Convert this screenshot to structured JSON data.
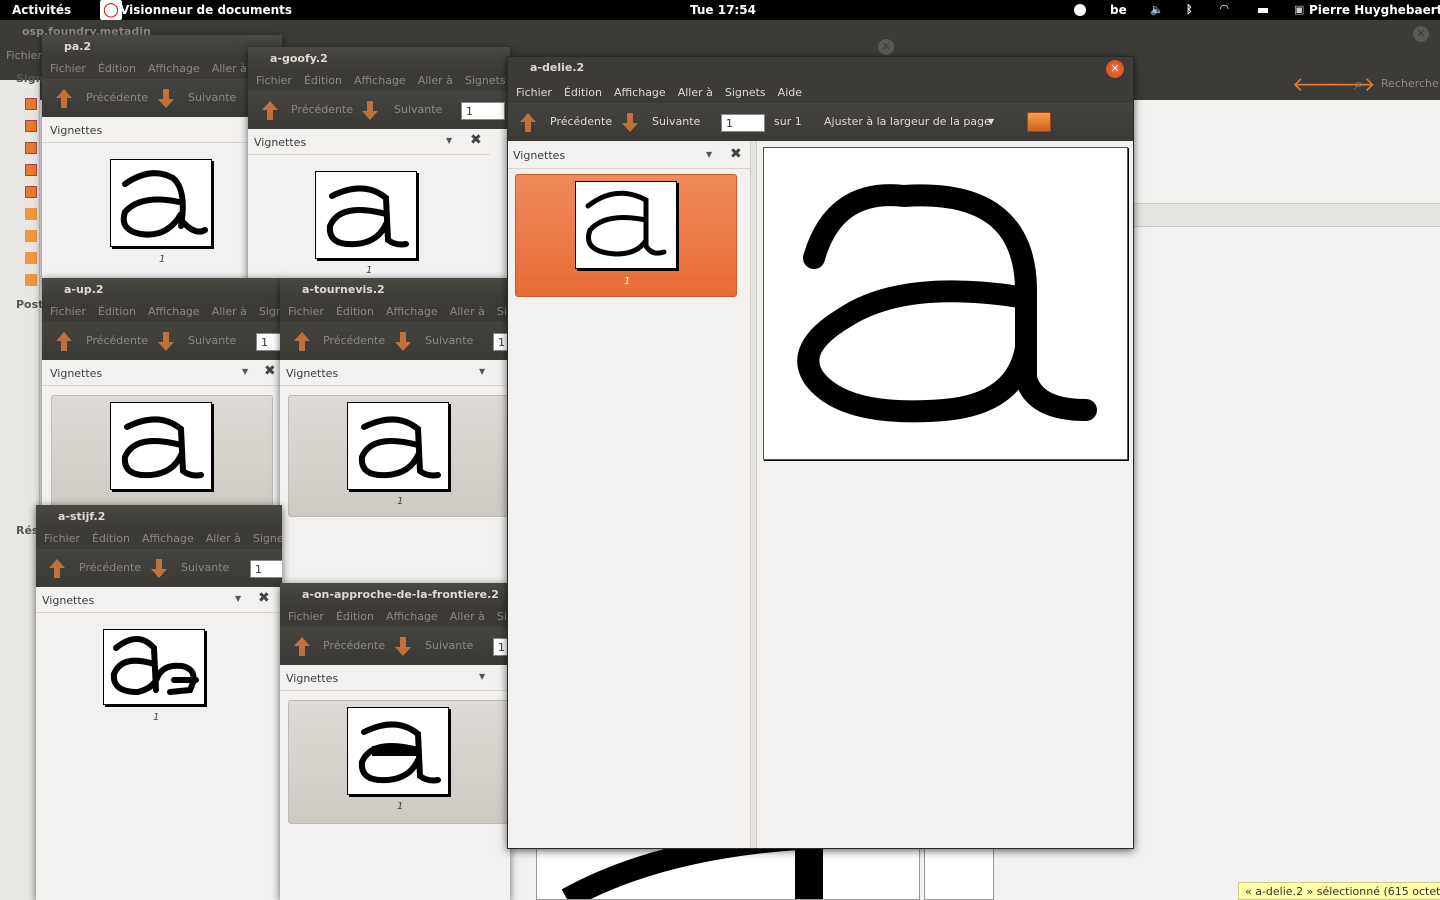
{
  "topbar": {
    "activities": "Activités",
    "app": "Visionneur de documents",
    "clock": "Tue 17:54",
    "keyboard": "be",
    "user": "Pierre Huyghebaert"
  },
  "bg_window": {
    "title": "osp.foundry.metadin",
    "menu_first": "Fichier",
    "search_label": "Recherche",
    "sidebar": [
      "Signe",
      "Poste",
      "Rése"
    ]
  },
  "menu": [
    "Fichier",
    "Édition",
    "Affichage",
    "Aller à",
    "Signets",
    "Aide"
  ],
  "toolbar": {
    "prev": "Précédente",
    "next": "Suivante",
    "page_value": "1",
    "of_pages": "sur 1",
    "zoom": "Ajuster à la largeur de la page"
  },
  "sidebar_title": "Vignettes",
  "page_label": "1",
  "windows": {
    "pa": {
      "title": "pa.2"
    },
    "goofy": {
      "title": "a-goofy.2"
    },
    "up": {
      "title": "a-up.2"
    },
    "tournevis": {
      "title": "a-tournevis.2"
    },
    "stijf": {
      "title": "a-stijf.2"
    },
    "frontiere": {
      "title": "a-on-approche-de-la-frontiere.2"
    },
    "delie": {
      "title": "a-delie.2"
    }
  },
  "status": "« a-delie.2 » sélectionné (615 octets)",
  "colors": {
    "accent": "#e86c37",
    "arrow": "#c0703a",
    "titlebar": "#3c3b37"
  },
  "icons": [
    "accessibility-icon",
    "volume-icon",
    "bluetooth-icon",
    "wifi-icon",
    "battery-icon",
    "user-icon",
    "folder-icon",
    "close-icon"
  ]
}
